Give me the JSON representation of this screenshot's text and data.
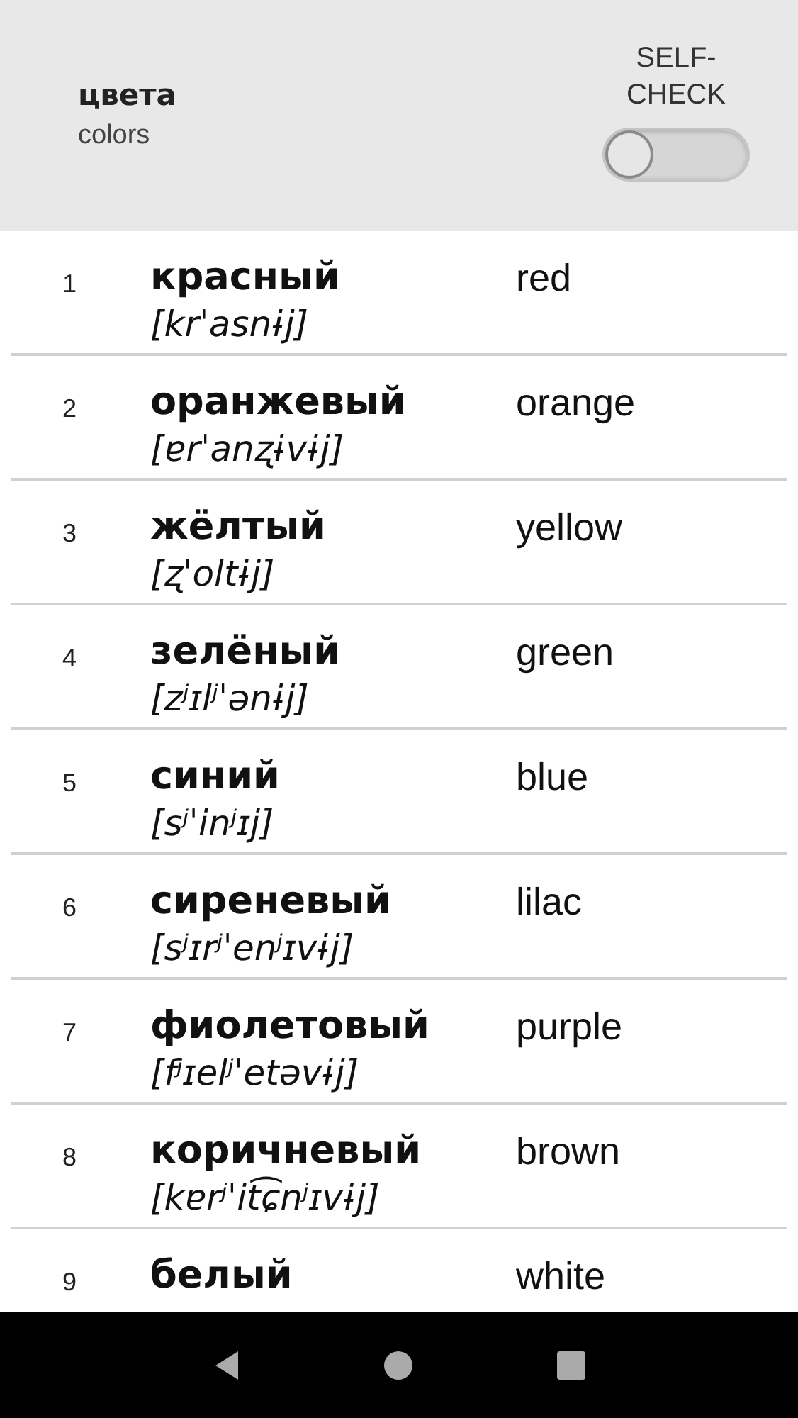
{
  "header": {
    "title": "цвета",
    "subtitle": "colors",
    "self_check": {
      "label": "SELF-CHECK",
      "checked": false
    }
  },
  "words": [
    {
      "number": "1",
      "word": "красный",
      "transcription": "[krˈasnɨj]",
      "translation": "red"
    },
    {
      "number": "2",
      "word": "оранжевый",
      "transcription": "[ɐrˈanʐɨvɨj]",
      "translation": "orange"
    },
    {
      "number": "3",
      "word": "жёлтый",
      "transcription": "[ʐˈoltɨj]",
      "translation": "yellow"
    },
    {
      "number": "4",
      "word": "зелёный",
      "transcription": "[zʲɪlʲˈənɨj]",
      "translation": "green"
    },
    {
      "number": "5",
      "word": "синий",
      "transcription": "[sʲˈinʲɪj]",
      "translation": "blue"
    },
    {
      "number": "6",
      "word": "сиреневый",
      "transcription": "[sʲɪrʲˈenʲɪvɨj]",
      "translation": "lilac"
    },
    {
      "number": "7",
      "word": "фиолетовый",
      "transcription": "[fʲɪelʲˈetəvɨj]",
      "translation": "purple"
    },
    {
      "number": "8",
      "word": "коричневый",
      "transcription": "[kɐrʲˈit͡ɕnʲɪvɨj]",
      "translation": "brown"
    },
    {
      "number": "9",
      "word": "белый",
      "translation": "white"
    }
  ]
}
